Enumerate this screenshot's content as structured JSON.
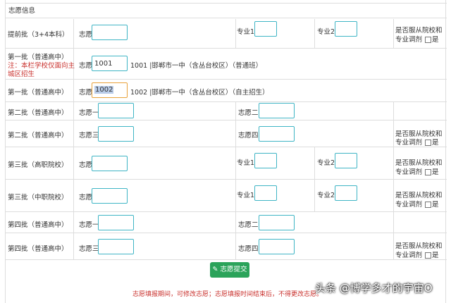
{
  "section_title": "志愿信息",
  "adjust_text_line1": "是否服从院校和",
  "adjust_text_line2": "专业调剂",
  "adjust_yes": "是",
  "rows": {
    "r1": {
      "label": "提前批（3+4本科）",
      "vol": "志愿",
      "major1": "专业1",
      "major2": "专业2"
    },
    "r2": {
      "label": "第一批（普通高中）",
      "note1": "注：本栏学校仅面向主",
      "note2": "城区招生",
      "vol": "志愿",
      "value": "1001",
      "desc": "1001 |邯郸市一中（含丛台校区）（普通班）"
    },
    "r3": {
      "label": "第一批（普通高中）",
      "vol": "志愿",
      "value": "1002",
      "desc": "1002 |邯郸市一中（含丛台校区）（自主招生）"
    },
    "r4": {
      "label": "第二批（普通高中）",
      "vol_a": "志愿一",
      "vol_b": "志愿二"
    },
    "r5": {
      "label": "第二批（普通高中）",
      "vol_a": "志愿三",
      "vol_b": "志愿四"
    },
    "r6": {
      "label": "第三批（高职院校）",
      "vol": "志愿",
      "major1": "专业1",
      "major2": "专业2"
    },
    "r7": {
      "label": "第三批（中职院校）",
      "vol": "志愿",
      "major1": "专业1",
      "major2": "专业2"
    },
    "r8": {
      "label": "第四批（普通高中）",
      "vol_a": "志愿一",
      "vol_b": "志愿二"
    },
    "r9": {
      "label": "第四批（普通高中）",
      "vol_a": "志愿三",
      "vol_b": "志愿四"
    }
  },
  "submit_label": "志愿提交",
  "footer_note": "志愿填报期间，可修改志愿；志愿填报时间结束后，不得更改志愿。",
  "watermark": "头条 @博学多才的宇宙O",
  "colors": {
    "input_border": "#3fb5c5",
    "active_border": "#e8a23b",
    "submit_bg": "#2ba35a",
    "note_red": "#c9302c"
  }
}
